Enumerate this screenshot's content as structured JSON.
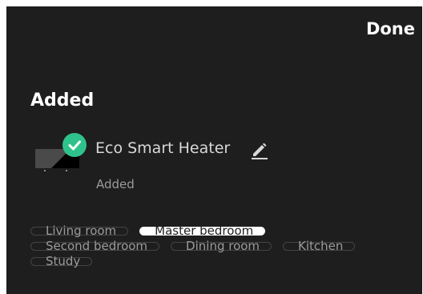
{
  "header": {
    "done_label": "Done"
  },
  "section": {
    "title": "Added"
  },
  "device": {
    "name": "Eco Smart Heater",
    "status": "Added",
    "status_icon": "check-circle-icon",
    "edit_icon": "pencil-icon"
  },
  "rooms": [
    {
      "label": "Living room",
      "selected": false
    },
    {
      "label": "Master bedroom",
      "selected": true
    },
    {
      "label": "Second bedroom",
      "selected": false
    },
    {
      "label": "Dining room",
      "selected": false
    },
    {
      "label": "Kitchen",
      "selected": false
    },
    {
      "label": "Study",
      "selected": false
    }
  ],
  "colors": {
    "background": "#1e1e1e",
    "accent_green": "#2fc28d",
    "selected_chip": "#ffffff"
  }
}
